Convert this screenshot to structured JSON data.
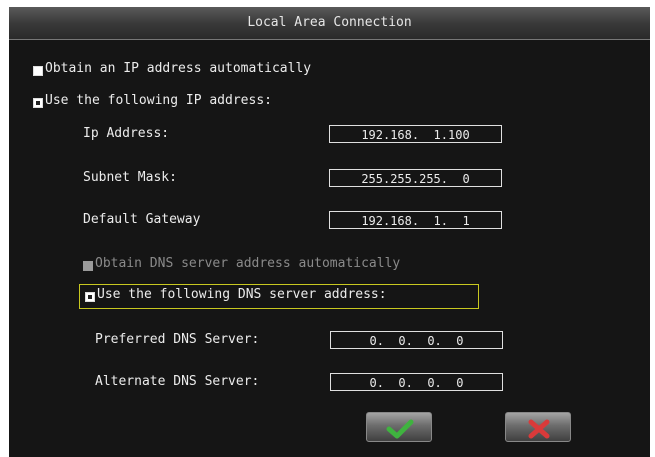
{
  "window": {
    "title": "Local Area Connection"
  },
  "ip": {
    "auto_label": "Obtain an IP address automatically",
    "manual_label": "Use the following IP address:",
    "address_label": "Ip Address:",
    "address_value": "192.168.  1.100",
    "mask_label": "Subnet Mask:",
    "mask_value": "255.255.255.  0",
    "gateway_label": "Default Gateway",
    "gateway_value": "192.168.  1.  1"
  },
  "dns": {
    "auto_label": "Obtain DNS server address automatically",
    "manual_label": "Use the following DNS server address:",
    "preferred_label": "Preferred DNS Server:",
    "preferred_value": "0.  0.  0.  0",
    "alternate_label": "Alternate DNS Server:",
    "alternate_value": "0.  0.  0.  0"
  },
  "buttons": {
    "ok_icon": "check-icon",
    "cancel_icon": "x-icon"
  },
  "colors": {
    "ok": "#3fb33f",
    "cancel": "#d93a3a",
    "focus": "#c8c820"
  }
}
